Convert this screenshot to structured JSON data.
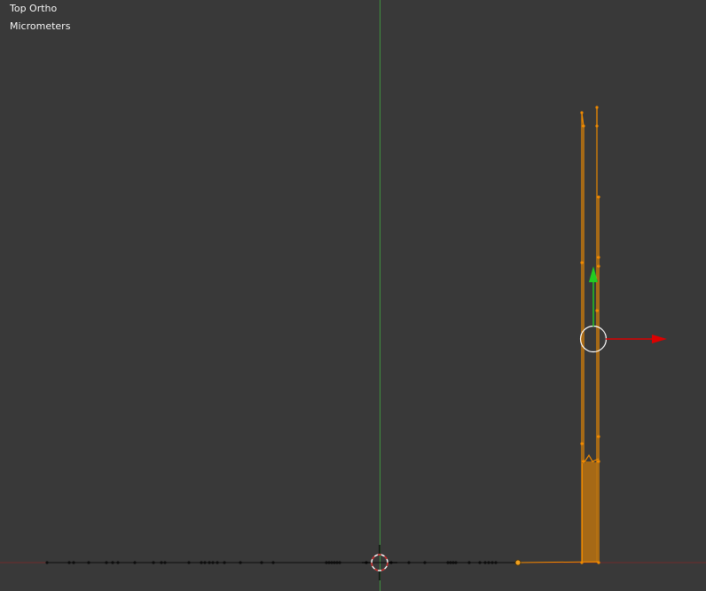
{
  "viewport": {
    "view_name": "Top Ortho",
    "units": "Micrometers",
    "background_color": "#393939",
    "x_axis_color": "#8a1f1f",
    "y_axis_color": "#3f8f3f",
    "selection_color": "#f08a00",
    "unselected_color": "#111111",
    "cursor_color": "#cc2222",
    "gizmo_x_color": "#dd0000",
    "gizmo_y_color": "#22cc22",
    "gizmo_ring_color": "#ffffff"
  },
  "scene": {
    "unselected_vertex_count": 66,
    "selected_object": "mesh",
    "icons": [
      "3d-cursor-icon",
      "transform-gizmo-icon",
      "origin-dot-icon"
    ]
  }
}
